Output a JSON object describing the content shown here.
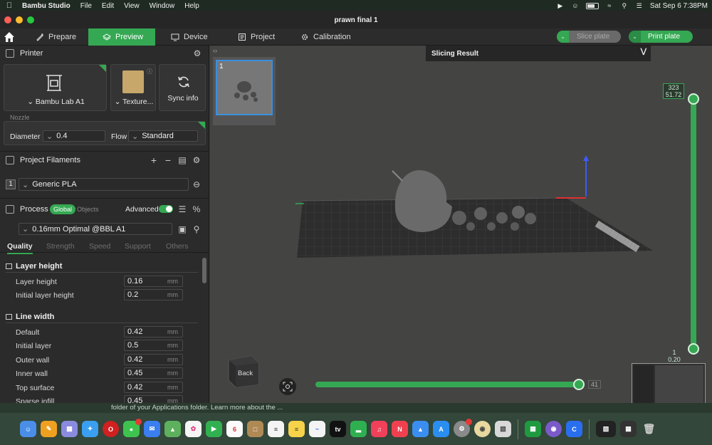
{
  "menubar": {
    "app_name": "Bambu Studio",
    "menus": [
      "File",
      "Edit",
      "View",
      "Window",
      "Help"
    ],
    "clock": "Sat Sep 6  7:38PM"
  },
  "window": {
    "title": "prawn final 1"
  },
  "toolbar": {
    "tabs": [
      {
        "label": "Prepare"
      },
      {
        "label": "Preview"
      },
      {
        "label": "Device"
      },
      {
        "label": "Project"
      },
      {
        "label": "Calibration"
      }
    ],
    "slice_label": "Slice plate",
    "print_label": "Print plate"
  },
  "printer": {
    "title": "Printer",
    "printer_name": "Bambu Lab A1",
    "plate_name": "Texture...",
    "sync_label": "Sync info",
    "nozzle_label": "Nozzle",
    "diameter_label": "Diameter",
    "diameter_value": "0.4",
    "flow_label": "Flow",
    "flow_value": "Standard"
  },
  "filaments": {
    "title": "Project Filaments",
    "items": [
      {
        "index": "1",
        "name": "Generic PLA"
      }
    ]
  },
  "process": {
    "title": "Process",
    "scope_global": "Global",
    "scope_objects": "Objects",
    "advanced_label": "Advanced",
    "preset": "0.16mm Optimal @BBL A1",
    "tabs": [
      "Quality",
      "Strength",
      "Speed",
      "Support",
      "Others"
    ],
    "groups": [
      {
        "title": "Layer height",
        "rows": [
          {
            "label": "Layer height",
            "value": "0.16",
            "unit": "mm"
          },
          {
            "label": "Initial layer height",
            "value": "0.2",
            "unit": "mm"
          }
        ]
      },
      {
        "title": "Line width",
        "rows": [
          {
            "label": "Default",
            "value": "0.42",
            "unit": "mm"
          },
          {
            "label": "Initial layer",
            "value": "0.5",
            "unit": "mm"
          },
          {
            "label": "Outer wall",
            "value": "0.42",
            "unit": "mm"
          },
          {
            "label": "Inner wall",
            "value": "0.45",
            "unit": "mm"
          },
          {
            "label": "Top surface",
            "value": "0.42",
            "unit": "mm"
          },
          {
            "label": "Sparse infill",
            "value": "0.45",
            "unit": "mm"
          }
        ]
      }
    ]
  },
  "viewport": {
    "plate_number": "1",
    "slicing_result_title": "Slicing Result",
    "layer_top_count": "323",
    "layer_top_height": "51.72",
    "layer_bottom_count": "1",
    "layer_bottom_height": "0.20",
    "move_value": "41",
    "back_label": "Back"
  },
  "notice": {
    "text": "folder of your Applications folder. Learn more about the ..."
  },
  "colors": {
    "accent": "#35a853",
    "selection": "#3b8fe0"
  }
}
